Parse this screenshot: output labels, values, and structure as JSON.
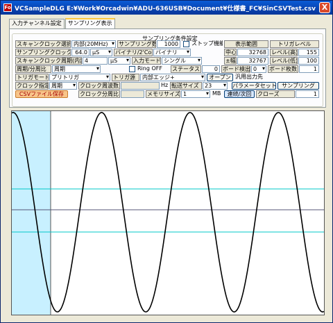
{
  "window": {
    "title": "VCSampleDLG  E:¥Work¥Orcadwin¥ADU-636USB¥Document¥仕様書_FC¥SinCSVTest.csv",
    "icon_text": "Fo",
    "close": "X"
  },
  "tabs": [
    {
      "label": "入力チャンネル設定",
      "active": false
    },
    {
      "label": "サンプリング表示",
      "active": true
    }
  ],
  "group_title": "サンプリング条件設定",
  "controls": {
    "scan_clock_select_label": "スキャンクロック選択",
    "scan_clock_select_value": "内部(20MHz)",
    "sampling_count_label": "サンプリング数",
    "sampling_count_value": "1000",
    "stop_function_label": "ストップ機能",
    "display_range_label": "表示範囲",
    "trigger_level_label": "トリガレベル",
    "sampling_clock_label": "サンプリングクロック",
    "sampling_clock_value": "64.0",
    "sampling_clock_unit": "μS",
    "binary_label": "バイナリ/2'Comp",
    "binary_value": "バイナリ",
    "center_label": "中心",
    "center_value": "32768",
    "level_high_label": "レベル(高)",
    "level_high_value": "155",
    "scan_clock_period_label": "スキャンクロック周期(内部)",
    "scan_clock_period_value": "4",
    "scan_clock_period_unit": "μS",
    "input_mode_label": "入力モード",
    "input_mode_value": "シングル",
    "amplitude_label": "±幅",
    "amplitude_value": "32767",
    "level_low_label": "レベル(低)",
    "level_low_value": "100",
    "period_duty_label": "周期/分周比",
    "period_duty_value": "周期",
    "ring_off_label": "Ring OFF",
    "status_label": "ステータス",
    "status_value": "0",
    "board_detect_label": "ボード検出",
    "board_detect_value": "0",
    "board_count_label": "ボード枚数",
    "board_count_value": "1",
    "trigger_mode_label": "トリガモード",
    "trigger_mode_value": "プリトリガ",
    "trigger_source_label": "トリガ源",
    "trigger_source_value": "内部エッジ+",
    "open_button": "オープン",
    "general_output_label": "汎用出力先",
    "clock_spec_label": "クロック指定",
    "clock_spec_value": "周期",
    "clock_frequency_label": "クロック周波数",
    "clock_frequency_unit": "Hz",
    "transfer_size_label": "転送サイズ",
    "transfer_size_value": "23",
    "param_set_button": "パラメータセット",
    "sampling_button": "サンプリング",
    "csv_save_button": "CSVファイル保存",
    "clock_duty_label": "クロック分周比",
    "memory_size_label": "メモリサイズ",
    "memory_size_value": "1",
    "mb_label": "MB",
    "continuous_button": "連続/次回",
    "close_label": "クローズ",
    "close_value": "1"
  },
  "plot": {
    "background": "#ffffff",
    "wave_color": "#000000",
    "guide_color": "#00c8c8",
    "highlight_color": "#c8f0ff",
    "cycles": 3.5
  }
}
